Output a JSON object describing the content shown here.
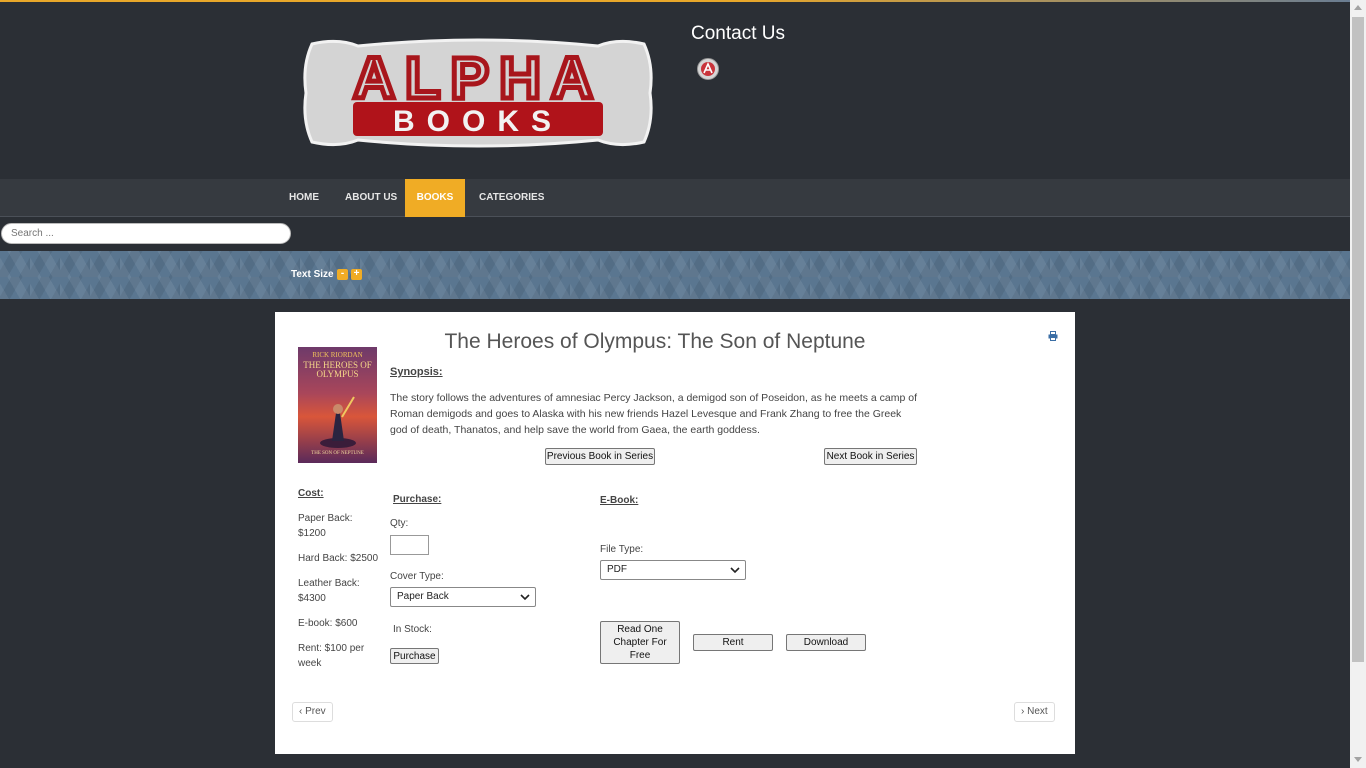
{
  "header": {
    "logo_text_top": "ALPHA",
    "logo_text_bottom": "BOOKS",
    "contact_label": "Contact Us",
    "login_icon": "user-icon"
  },
  "nav": {
    "items": [
      {
        "label": "HOME",
        "active": false
      },
      {
        "label": "ABOUT US",
        "active": false
      },
      {
        "label": "BOOKS",
        "active": true
      },
      {
        "label": "CATEGORIES",
        "active": false
      }
    ]
  },
  "search": {
    "placeholder": "Search ..."
  },
  "banner": {
    "text_size_label": "Text Size",
    "decrease": "-",
    "increase": "+"
  },
  "book": {
    "title": "The Heroes of Olympus: The Son of Neptune",
    "cover": {
      "author": "RICK RIORDAN",
      "series": "THE HEROES OF OLYMPUS",
      "subtitle": "THE SON OF NEPTUNE"
    },
    "synopsis_heading": "Synopsis:",
    "synopsis": "The story follows the adventures of amnesiac Percy Jackson, a demigod son of Poseidon, as he meets a camp of Roman demigods and goes to Alaska with his new friends Hazel Levesque and Frank Zhang to free the Greek god of death, Thanatos, and help save the world from Gaea, the earth goddess.",
    "prev_series_label": "Previous Book in Series",
    "next_series_label": "Next Book in Series"
  },
  "cost": {
    "heading": "Cost:",
    "items": [
      "Paper Back: $1200",
      "Hard Back: $2500",
      "Leather Back: $4300",
      "E-book: $600",
      "Rent: $100 per week"
    ]
  },
  "purchase": {
    "heading": "Purchase:",
    "qty_label": "Qty:",
    "qty_value": "",
    "cover_type_label": "Cover Type:",
    "cover_type_value": "Paper Back",
    "in_stock_label": "In Stock:",
    "purchase_button": "Purchase"
  },
  "ebook": {
    "heading": "E-Book:",
    "file_type_label": "File Type:",
    "file_type_value": "PDF",
    "read_chapter_button": "Read One Chapter For Free",
    "rent_button": "Rent",
    "download_button": "Download"
  },
  "pager": {
    "prev": "Prev",
    "next": "Next"
  },
  "colors": {
    "accent": "#f0ac25",
    "background": "#2b2f35",
    "banner": "#5a7690"
  }
}
